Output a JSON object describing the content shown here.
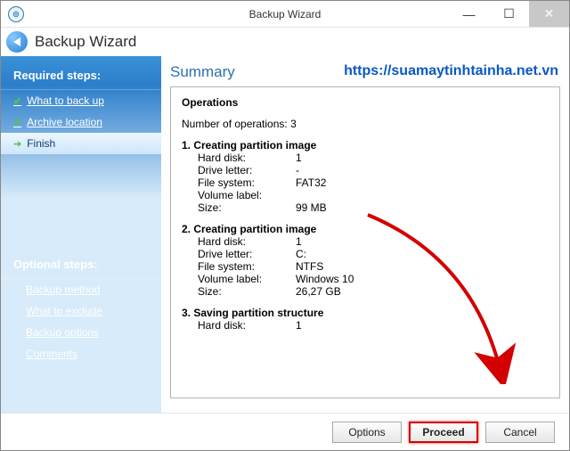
{
  "titlebar": {
    "title": "Backup Wizard"
  },
  "header": {
    "title": "Backup Wizard"
  },
  "sidebar": {
    "required_label": "Required steps:",
    "items": [
      {
        "label": "What to back up"
      },
      {
        "label": "Archive location"
      },
      {
        "label": "Finish"
      }
    ],
    "optional_label": "Optional steps:",
    "optional": [
      {
        "label": "Backup method"
      },
      {
        "label": "What to exclude"
      },
      {
        "label": "Backup options"
      },
      {
        "label": "Comments"
      }
    ]
  },
  "main": {
    "summary_title": "Summary",
    "watermark": "https://suamaytinhtainha.net.vn",
    "ops_heading": "Operations",
    "num_ops_label": "Number of operations: 3",
    "ops": [
      {
        "title": "1. Creating partition image",
        "rows": [
          {
            "label": "Hard disk:",
            "value": "1"
          },
          {
            "label": "Drive letter:",
            "value": "-"
          },
          {
            "label": "File system:",
            "value": "FAT32"
          },
          {
            "label": "Volume label:",
            "value": ""
          },
          {
            "label": "Size:",
            "value": "99 MB"
          }
        ]
      },
      {
        "title": "2. Creating partition image",
        "rows": [
          {
            "label": "Hard disk:",
            "value": "1"
          },
          {
            "label": "Drive letter:",
            "value": "C:"
          },
          {
            "label": "File system:",
            "value": "NTFS"
          },
          {
            "label": "Volume label:",
            "value": "Windows 10"
          },
          {
            "label": "Size:",
            "value": "26,27 GB"
          }
        ]
      },
      {
        "title": "3. Saving partition structure",
        "rows": [
          {
            "label": "Hard disk:",
            "value": "1"
          }
        ]
      }
    ]
  },
  "footer": {
    "options": "Options",
    "proceed": "Proceed",
    "cancel": "Cancel"
  }
}
